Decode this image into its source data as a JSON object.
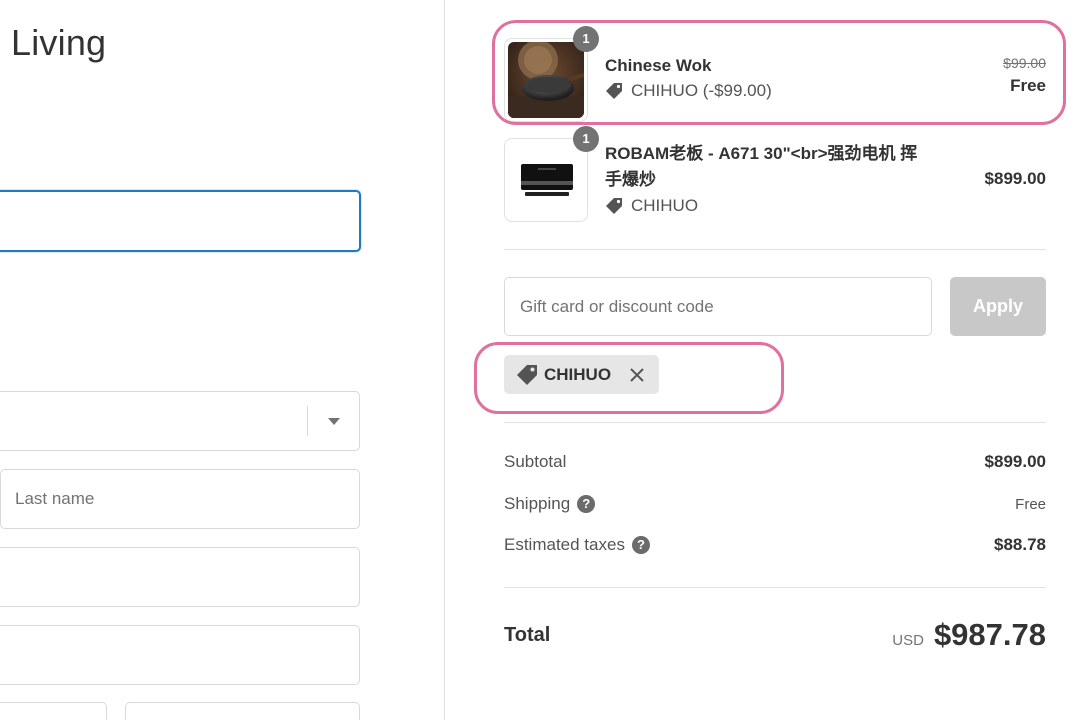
{
  "store": {
    "name": "Living"
  },
  "form": {
    "last_name_placeholder": "Last name"
  },
  "cart": {
    "items": [
      {
        "name": "Chinese Wok",
        "quantity": "1",
        "discount_label": "CHIHUO (-$99.00)",
        "original_price": "$99.00",
        "price": "Free",
        "thumb_icon": "wok-image"
      },
      {
        "name_line1": "ROBAM老板 - A671 30\"<br>强劲电机 挥",
        "name_line2": "手爆炒",
        "quantity": "1",
        "discount_label": "CHIHUO",
        "price": "$899.00",
        "thumb_icon": "range-hood-image"
      }
    ]
  },
  "discount": {
    "placeholder": "Gift card or discount code",
    "apply_label": "Apply",
    "applied_code": "CHIHUO"
  },
  "summary": {
    "subtotal_label": "Subtotal",
    "subtotal_value": "$899.00",
    "shipping_label": "Shipping",
    "shipping_value": "Free",
    "taxes_label": "Estimated taxes",
    "taxes_value": "$88.78",
    "total_label": "Total",
    "currency": "USD",
    "total_value": "$987.78"
  },
  "icons": {
    "info": "?",
    "tag": "tag-icon",
    "close": "close-icon"
  },
  "colors": {
    "highlight": "#e070a0",
    "focus": "#1f7ac4",
    "apply_disabled": "#c8c8c8"
  }
}
